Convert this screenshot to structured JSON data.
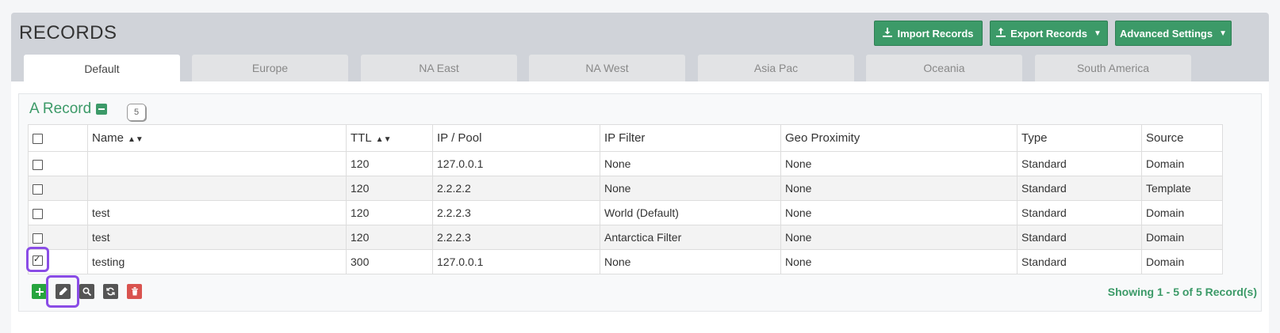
{
  "page_title": "RECORDS",
  "header_buttons": {
    "import": "Import Records",
    "export": "Export Records",
    "advanced": "Advanced Settings"
  },
  "tabs": [
    "Default",
    "Europe",
    "NA East",
    "NA West",
    "Asia Pac",
    "Oceania",
    "South America"
  ],
  "section": {
    "title": "A Record",
    "count": "5"
  },
  "table": {
    "headers": [
      "Name",
      "TTL",
      "IP / Pool",
      "IP Filter",
      "Geo Proximity",
      "Type",
      "Source"
    ],
    "rows": [
      {
        "checked": false,
        "name": "",
        "ttl": "120",
        "ip": "127.0.0.1",
        "filter": "None",
        "geo": "None",
        "type": "Standard",
        "source": "Domain"
      },
      {
        "checked": false,
        "name": "",
        "ttl": "120",
        "ip": "2.2.2.2",
        "filter": "None",
        "geo": "None",
        "type": "Standard",
        "source": "Template"
      },
      {
        "checked": false,
        "name": "test",
        "ttl": "120",
        "ip": "2.2.2.3",
        "filter": "World (Default)",
        "geo": "None",
        "type": "Standard",
        "source": "Domain"
      },
      {
        "checked": false,
        "name": "test",
        "ttl": "120",
        "ip": "2.2.2.3",
        "filter": "Antarctica Filter",
        "geo": "None",
        "type": "Standard",
        "source": "Domain"
      },
      {
        "checked": true,
        "name": "testing",
        "ttl": "300",
        "ip": "127.0.0.1",
        "filter": "None",
        "geo": "None",
        "type": "Standard",
        "source": "Domain"
      }
    ]
  },
  "toolbar_icons": [
    "plus-icon",
    "pencil-icon",
    "search-icon",
    "refresh-icon",
    "trash-icon"
  ],
  "status_text": "Showing 1 - 5 of 5 Record(s)",
  "colors": {
    "accent": "#3c9a68",
    "highlight": "#8a4ce6",
    "danger": "#d9534f",
    "dark": "#555555"
  }
}
